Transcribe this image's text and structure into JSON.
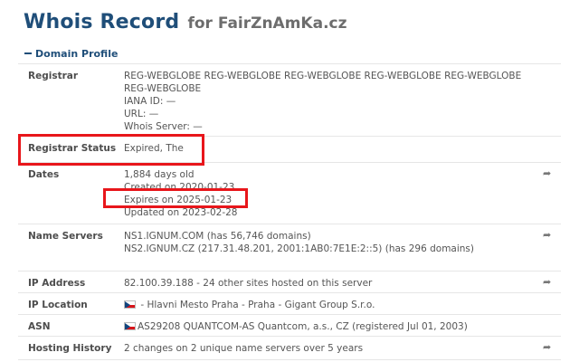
{
  "header": {
    "title": "Whois Record",
    "subtitle": "for FairZnAmKa.cz"
  },
  "section": {
    "label": "Domain Profile"
  },
  "rows": {
    "registrar": {
      "label": "Registrar",
      "lines": [
        "REG-WEBGLOBE REG-WEBGLOBE REG-WEBGLOBE REG-WEBGLOBE REG-WEBGLOBE REG-WEBGLOBE",
        "IANA ID: —",
        "URL: —",
        "Whois Server: —"
      ]
    },
    "status": {
      "label": "Registrar Status",
      "value": "Expired, The"
    },
    "dates": {
      "label": "Dates",
      "lines": [
        "1,884 days old",
        "Created on 2020-01-23",
        "Expires on 2025-01-23",
        "Updated on 2023-02-28"
      ]
    },
    "nameservers": {
      "label": "Name Servers",
      "lines": [
        "NS1.IGNUM.COM (has 56,746 domains)",
        "NS2.IGNUM.CZ (217.31.48.201, 2001:1AB0:7E1E:2::5) (has 296 domains)"
      ]
    },
    "ip": {
      "label": "IP Address",
      "value": "82.100.39.188 - 24 other sites hosted on this server"
    },
    "location": {
      "label": "IP Location",
      "value": " - Hlavni Mesto Praha - Praha - Gigant Group S.r.o."
    },
    "asn": {
      "label": "ASN",
      "value": "AS29208 QUANTCOM-AS Quantcom, a.s., CZ (registered Jul 01, 2003)"
    },
    "history": {
      "label": "Hosting History",
      "value": "2 changes on 2 unique name servers over 5 years"
    }
  },
  "icons": {
    "share": "share-arrow-icon",
    "flag": "czech-flag-icon"
  },
  "colors": {
    "title": "#1f4e79",
    "highlight": "#e8161b"
  }
}
